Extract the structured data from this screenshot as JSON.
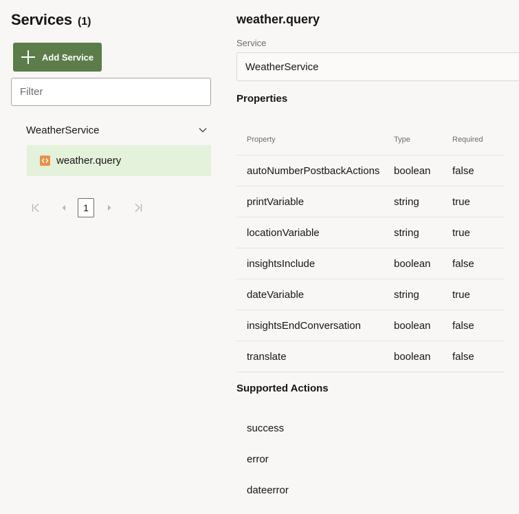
{
  "sidebar": {
    "title": "Services",
    "count": "(1)",
    "add_button_label": "Add Service",
    "filter_placeholder": "Filter",
    "group_name": "WeatherService",
    "item_label": "weather.query",
    "pager": {
      "current_page": "1"
    }
  },
  "detail": {
    "title": "weather.query",
    "service_label": "Service",
    "service_value": "WeatherService",
    "properties_heading": "Properties",
    "table": {
      "headers": [
        "Property",
        "Type",
        "Required"
      ],
      "rows": [
        [
          "autoNumberPostbackActions",
          "boolean",
          "false"
        ],
        [
          "printVariable",
          "string",
          "true"
        ],
        [
          "locationVariable",
          "string",
          "true"
        ],
        [
          "insightsInclude",
          "boolean",
          "false"
        ],
        [
          "dateVariable",
          "string",
          "true"
        ],
        [
          "insightsEndConversation",
          "boolean",
          "false"
        ],
        [
          "translate",
          "boolean",
          "false"
        ]
      ]
    },
    "actions_heading": "Supported Actions",
    "actions": [
      "success",
      "error",
      "dateerror"
    ]
  },
  "colors": {
    "primary_button": "#5c7d4a",
    "selected_item_bg": "#e4f1db",
    "component_icon": "#e8914a"
  },
  "icons": {
    "add": "plus-icon",
    "expand": "chevron-down-icon",
    "component": "component-icon",
    "first": "first-page-icon",
    "prev": "previous-page-icon",
    "next": "next-page-icon",
    "last": "last-page-icon"
  }
}
